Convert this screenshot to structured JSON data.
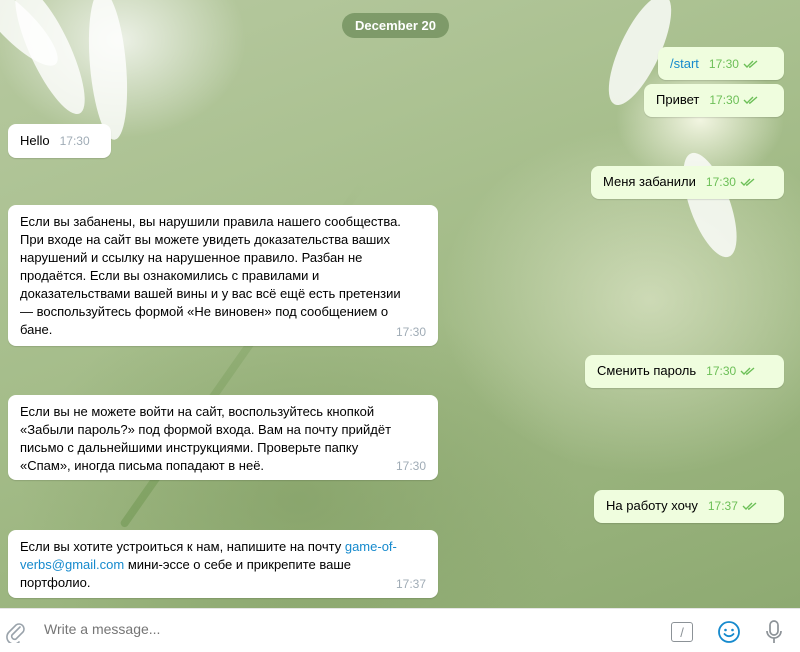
{
  "date_label": "December 20",
  "messages": [
    {
      "dir": "out",
      "text": "/start",
      "time": "17:30",
      "is_command": true
    },
    {
      "dir": "out",
      "text": "Привет",
      "time": "17:30"
    },
    {
      "dir": "in",
      "text": "Hello",
      "time": "17:30"
    },
    {
      "dir": "out",
      "text": "Меня забанили",
      "time": "17:30"
    },
    {
      "dir": "in",
      "text": "Если вы забанены, вы нарушили правила нашего сообщества.\nПри входе на сайт вы можете увидеть доказательства ваших\nнарушений и ссылку на нарушенное правило. Разбан не\nпродаётся. Если вы ознакомились с правилами и\nдоказательствами вашей вины и у вас всё ещё есть претензии\n— воспользуйтесь формой «Не виновен» под сообщением о\nбане.",
      "time": "17:30"
    },
    {
      "dir": "out",
      "text": "Сменить пароль",
      "time": "17:30"
    },
    {
      "dir": "in",
      "text": "Если вы не можете войти на сайт, воспользуйтесь кнопкой\n«Забыли пароль?» под формой входа. Вам на почту прийдёт\nписьмо с дальнейшими инструкциями. Проверьте папку\n«Спам», иногда письма попадают в неё.",
      "time": "17:30"
    },
    {
      "dir": "out",
      "text": "На работу хочу",
      "time": "17:37"
    },
    {
      "dir": "in",
      "text_before": "Если вы хотите устроиться к нам, напишите на почту ",
      "link": "game-of-\nverbs@gmail.com",
      "text_after": " мини-эссе о себе и прикрепите ваше\nпортфолио.",
      "time": "17:37"
    }
  ],
  "composer": {
    "placeholder": "Write a message...",
    "commands_label": "/",
    "icons": [
      "paperclip-icon",
      "commands-icon",
      "emoji-icon",
      "microphone-icon"
    ]
  },
  "colors": {
    "incoming_bubble": "#ffffff",
    "outgoing_bubble": "#effdde",
    "read_checks": "#6cbf57",
    "link": "#168acd",
    "date_chip": "#6e8c5a"
  }
}
